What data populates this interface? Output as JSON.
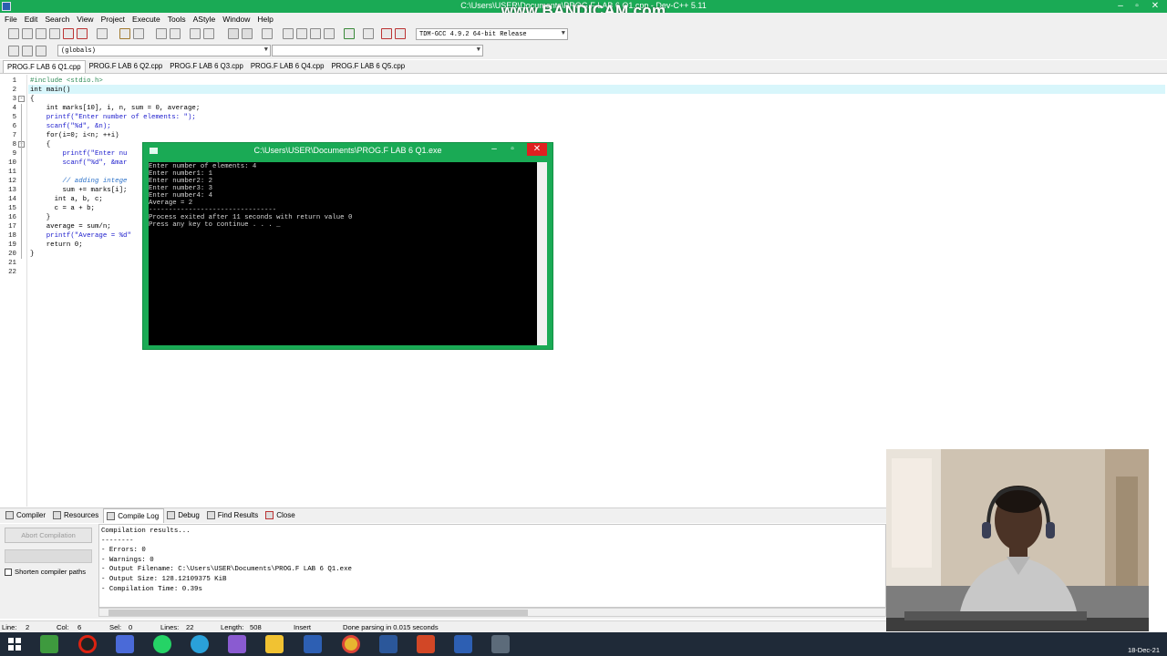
{
  "window": {
    "title": "C:\\Users\\USER\\Documents\\PROG.F LAB 6 Q1.cpp - Dev-C++ 5.11"
  },
  "watermark": "www.BANDICAM.com",
  "menu": [
    "File",
    "Edit",
    "Search",
    "View",
    "Project",
    "Execute",
    "Tools",
    "AStyle",
    "Window",
    "Help"
  ],
  "toolbar": {
    "compiler_select": "TDM-GCC 4.9.2 64-bit Release",
    "scope_select": "(globals)"
  },
  "tabs": [
    "PROG.F LAB 6 Q1.cpp",
    "PROG.F LAB 6 Q2.cpp",
    "PROG.F LAB 6 Q3.cpp",
    "PROG.F LAB 6 Q4.cpp",
    "PROG.F LAB 6 Q5.cpp"
  ],
  "active_tab": 0,
  "code": {
    "lines": [
      "#include <stdio.h>",
      "int main()",
      "{",
      "    int marks[10], i, n, sum = 0, average;",
      "    printf(\"Enter number of elements: \");",
      "    scanf(\"%d\", &n);",
      "    for(i=0; i<n; ++i)",
      "    {",
      "        printf(\"Enter nu",
      "        scanf(\"%d\", &mar",
      "",
      "        // adding intege",
      "        sum += marks[i];",
      "      int a, b, c;",
      "      c = a + b;",
      "    }",
      "    average = sum/n;",
      "    printf(\"Average = %d\"",
      "    return 0;",
      "}",
      "",
      ""
    ]
  },
  "console": {
    "title": "C:\\Users\\USER\\Documents\\PROG.F LAB 6 Q1.exe",
    "output": [
      "Enter number of elements: 4",
      "Enter number1: 1",
      "Enter number2: 2",
      "Enter number3: 3",
      "Enter number4: 4",
      "Average = 2",
      "--------------------------------",
      "Process exited after 11 seconds with return value 0",
      "Press any key to continue . . . _"
    ]
  },
  "bottom_tabs": [
    "Compiler",
    "Resources",
    "Compile Log",
    "Debug",
    "Find Results",
    "Close"
  ],
  "bottom_active_tab": 2,
  "bottom": {
    "abort_label": "Abort Compilation",
    "shorten_label": "Shorten compiler paths",
    "log": [
      "Compilation results...",
      "--------",
      "- Errors: 0",
      "- Warnings: 0",
      "- Output Filename: C:\\Users\\USER\\Documents\\PROG.F LAB 6 Q1.exe",
      "- Output Size: 128.12109375 KiB",
      "- Compilation Time: 0.39s"
    ]
  },
  "status": {
    "line_label": "Line:",
    "line": "2",
    "col_label": "Col:",
    "col": "6",
    "sel_label": "Sel:",
    "sel": "0",
    "lines_label": "Lines:",
    "lines": "22",
    "length_label": "Length:",
    "length": "508",
    "mode": "Insert",
    "message": "Done parsing in 0.015 seconds"
  },
  "taskbar": {
    "date": "18-Dec-21",
    "apps": [
      "start-icon",
      "app-icon",
      "record-icon",
      "browser-icon",
      "whatsapp-icon",
      "telegram-icon",
      "feather-icon",
      "explorer-icon",
      "devcpp-icon",
      "chrome-icon",
      "word-icon",
      "powerpoint-icon",
      "devcpp-icon",
      "console-icon"
    ]
  },
  "colors": {
    "titlebar": "#1aaa55",
    "console_bg": "#000000",
    "highlight_line": "#d8f6fb"
  }
}
